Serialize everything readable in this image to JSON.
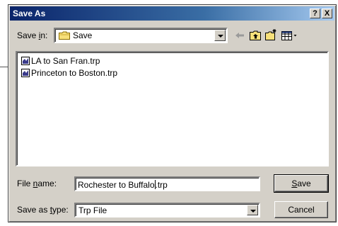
{
  "dialog": {
    "title": "Save As",
    "help_label": "?",
    "close_label": "X"
  },
  "save_in": {
    "label_prefix": "Save ",
    "label_accel": "i",
    "label_suffix": "n:",
    "value": "Save"
  },
  "toolbar": {
    "back_icon": "back-arrow-icon",
    "up_icon": "up-folder-icon",
    "new_folder_icon": "new-folder-icon",
    "view_icon": "view-menu-icon"
  },
  "files": [
    {
      "name": "LA to San Fran.trp"
    },
    {
      "name": "Princeton to Boston.trp"
    }
  ],
  "file_name": {
    "label_prefix": "File ",
    "label_accel": "n",
    "label_suffix": "ame:",
    "value_before_caret": "Rochester to Buffalo",
    "value_after_caret": ".trp"
  },
  "save_as_type": {
    "label_prefix": "Save as ",
    "label_accel": "t",
    "label_suffix": "ype:",
    "value": "Trp File"
  },
  "buttons": {
    "save_accel": "S",
    "save_rest": "ave",
    "cancel": "Cancel"
  }
}
